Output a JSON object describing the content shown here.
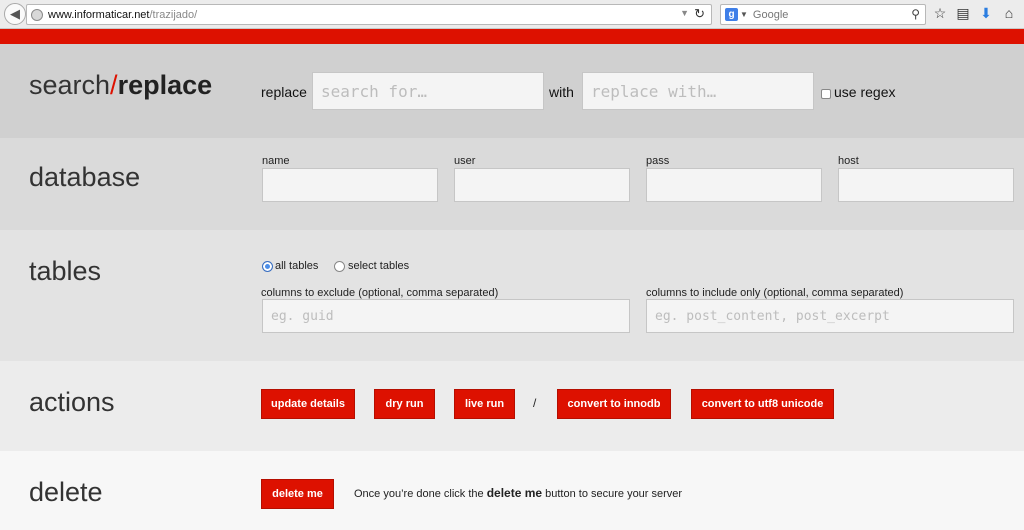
{
  "browser": {
    "url_host": "www.informaticar.net",
    "url_path": "/trazijado/",
    "search_placeholder": "Google"
  },
  "replace_section": {
    "title_left": "search",
    "title_slash": "/",
    "title_right": "replace",
    "replace_label": "replace",
    "search_placeholder": "search for…",
    "with_label": "with",
    "replace_placeholder": "replace with…",
    "regex_label": "use regex"
  },
  "database_section": {
    "title": "database",
    "name_label": "name",
    "user_label": "user",
    "pass_label": "pass",
    "host_label": "host"
  },
  "tables_section": {
    "title": "tables",
    "all_tables_label": "all tables",
    "select_tables_label": "select tables",
    "exclude_label": "columns to exclude (optional, comma separated)",
    "exclude_placeholder": "eg. guid",
    "include_label": "columns to include only (optional, comma separated)",
    "include_placeholder": "eg. post_content, post_excerpt"
  },
  "actions_section": {
    "title": "actions",
    "update_label": "update details",
    "dry_run_label": "dry run",
    "live_run_label": "live run",
    "separator": "/",
    "innodb_label": "convert to innodb",
    "utf8_label": "convert to utf8 unicode"
  },
  "delete_section": {
    "title": "delete",
    "button_label": "delete me",
    "note_prefix": "Once you’re done click the",
    "note_bold": "delete me",
    "note_suffix": "button to secure your server"
  },
  "colors": {
    "accent": "#dd1100",
    "radio_selected": "#4c8ee8"
  }
}
